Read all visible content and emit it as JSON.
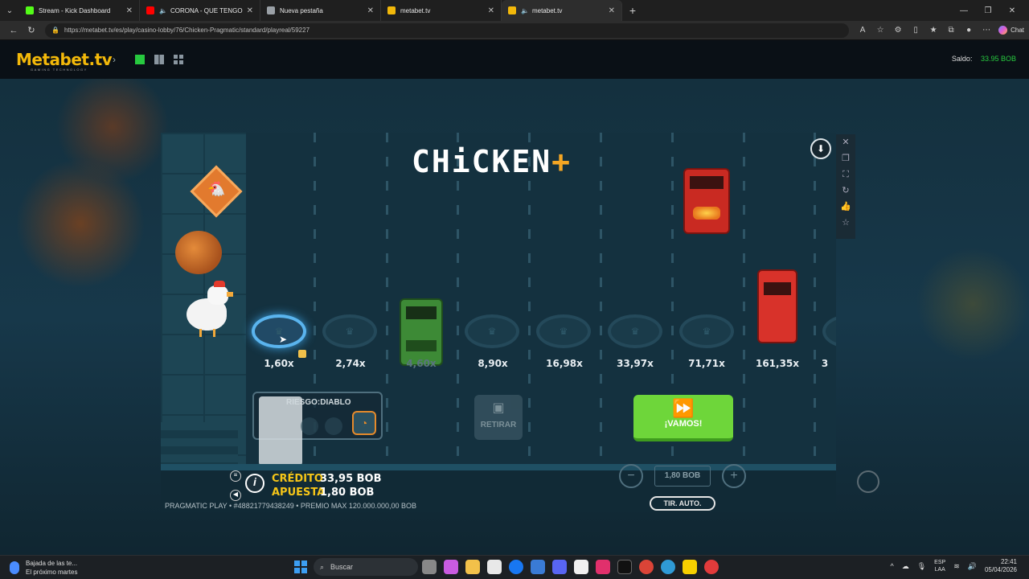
{
  "browser": {
    "tabs": [
      {
        "title": "Stream - Kick Dashboard",
        "favicon_color": "#53fc18",
        "active": false
      },
      {
        "title": "CORONA - QUE TENGO QUE",
        "favicon_color": "#ff0000",
        "active": false
      },
      {
        "title": "Nueva pestaña",
        "favicon_color": "#9aa0a6",
        "active": false
      },
      {
        "title": "metabet.tv",
        "favicon_color": "#f2b80a",
        "active": false
      },
      {
        "title": "metabet.tv",
        "favicon_color": "#f2b80a",
        "active": true
      }
    ],
    "url": "https://metabet.tv/es/play/casino-lobby/76/Chicken-Pragmatic/standard/playreal/59227",
    "copilot_label": "Chat"
  },
  "site": {
    "logo": "Metabet.tv",
    "logo_sub": "GAMING TECHNOLOGY",
    "saldo_label": "Saldo:",
    "saldo_value": "33.95 BOB"
  },
  "game": {
    "title": "CHiCKEN",
    "title_plus": "+",
    "multipliers": [
      "1,60x",
      "2,74x",
      "4,60x",
      "8,90x",
      "16,98x",
      "33,97x",
      "71,71x",
      "161,35x",
      "3"
    ],
    "risk_label": "RIESGO:",
    "risk_value": "DIABLO",
    "cashout_label": "RETIRAR",
    "go_label": "¡VAMOS!",
    "credit_label": "CRÉDITO",
    "credit_value": "33,95 BOB",
    "bet_label": "APUESTA",
    "bet_value": "1,80 BOB",
    "bet_amount": "1,80 BOB",
    "auto_label": "TIR. AUTO.",
    "footer": "PRAGMATIC PLAY • #48821779438249 • PREMIO MAX 120.000.000,00 BOB"
  },
  "taskbar": {
    "notif_title": "Bajada de las te...",
    "notif_sub": "El próximo martes",
    "search_placeholder": "Buscar",
    "lang_top": "ESP",
    "lang_bottom": "LAA",
    "time": "22:41",
    "date": "05/04/2026"
  }
}
